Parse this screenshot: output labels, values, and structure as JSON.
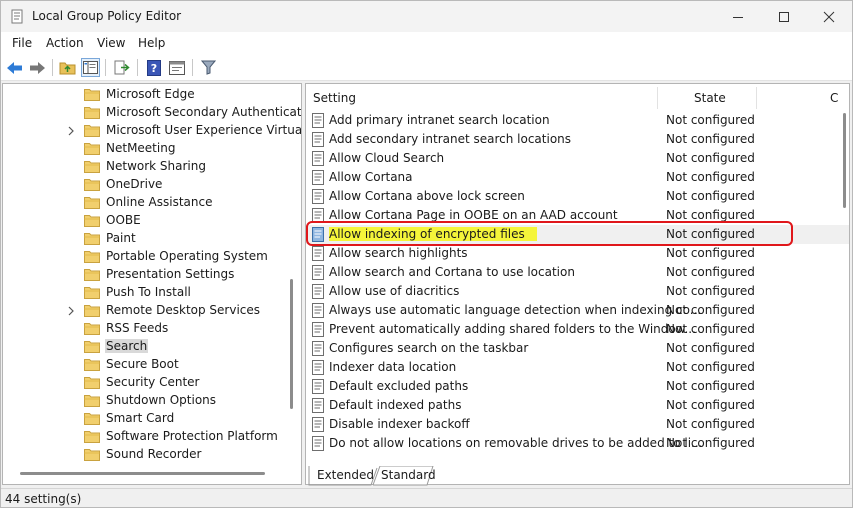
{
  "window": {
    "title": "Local Group Policy Editor"
  },
  "menu": [
    "File",
    "Action",
    "View",
    "Help"
  ],
  "toolbar": {
    "icons": [
      "back-arrow-icon",
      "forward-arrow-icon",
      "up-folder-icon",
      "show-hide-tree-icon",
      "export-list-icon",
      "help-icon",
      "properties-icon",
      "filter-icon"
    ]
  },
  "tree": {
    "items": [
      {
        "label": "Microsoft Edge",
        "expandable": false
      },
      {
        "label": "Microsoft Secondary Authenticati",
        "expandable": false
      },
      {
        "label": "Microsoft User Experience Virtuali",
        "expandable": true
      },
      {
        "label": "NetMeeting",
        "expandable": false
      },
      {
        "label": "Network Sharing",
        "expandable": false
      },
      {
        "label": "OneDrive",
        "expandable": false
      },
      {
        "label": "Online Assistance",
        "expandable": false
      },
      {
        "label": "OOBE",
        "expandable": false
      },
      {
        "label": "Paint",
        "expandable": false
      },
      {
        "label": "Portable Operating System",
        "expandable": false
      },
      {
        "label": "Presentation Settings",
        "expandable": false
      },
      {
        "label": "Push To Install",
        "expandable": false
      },
      {
        "label": "Remote Desktop Services",
        "expandable": true
      },
      {
        "label": "RSS Feeds",
        "expandable": false
      },
      {
        "label": "Search",
        "expandable": false,
        "selected": true
      },
      {
        "label": "Secure Boot",
        "expandable": false
      },
      {
        "label": "Security Center",
        "expandable": false
      },
      {
        "label": "Shutdown Options",
        "expandable": false
      },
      {
        "label": "Smart Card",
        "expandable": false
      },
      {
        "label": "Software Protection Platform",
        "expandable": false
      },
      {
        "label": "Sound Recorder",
        "expandable": false
      }
    ]
  },
  "list": {
    "columns": {
      "setting": "Setting",
      "state": "State",
      "comment": "C"
    },
    "rows": [
      {
        "setting": "Add primary intranet search location",
        "state": "Not configured"
      },
      {
        "setting": "Add secondary intranet search locations",
        "state": "Not configured"
      },
      {
        "setting": "Allow Cloud Search",
        "state": "Not configured"
      },
      {
        "setting": "Allow Cortana",
        "state": "Not configured"
      },
      {
        "setting": "Allow Cortana above lock screen",
        "state": "Not configured"
      },
      {
        "setting": "Allow Cortana Page in OOBE on an AAD account",
        "state": "Not configured"
      },
      {
        "setting": "Allow indexing of encrypted files",
        "state": "Not configured",
        "highlighted": true
      },
      {
        "setting": "Allow search highlights",
        "state": "Not configured"
      },
      {
        "setting": "Allow search and Cortana to use location",
        "state": "Not configured"
      },
      {
        "setting": "Allow use of diacritics",
        "state": "Not configured"
      },
      {
        "setting": "Always use automatic language detection when indexing co...",
        "state": "Not configured"
      },
      {
        "setting": "Prevent automatically adding shared folders to the Window...",
        "state": "Not configured"
      },
      {
        "setting": "Configures search on the taskbar",
        "state": "Not configured"
      },
      {
        "setting": "Indexer data location",
        "state": "Not configured"
      },
      {
        "setting": "Default excluded paths",
        "state": "Not configured"
      },
      {
        "setting": "Default indexed paths",
        "state": "Not configured"
      },
      {
        "setting": "Disable indexer backoff",
        "state": "Not configured"
      },
      {
        "setting": "Do not allow locations on removable drives to be added to li...",
        "state": "Not configured"
      }
    ]
  },
  "tabs": [
    {
      "label": "Extended"
    },
    {
      "label": "Standard",
      "active": true
    }
  ],
  "status": {
    "text": "44 setting(s)"
  },
  "colors": {
    "highlight_fill": "#f5f53a",
    "highlight_outline": "#e0171b",
    "folder": "#e8c15a"
  }
}
